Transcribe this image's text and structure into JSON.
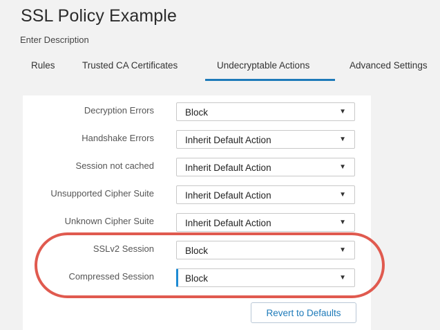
{
  "header": {
    "title": "SSL Policy Example",
    "description": "Enter Description"
  },
  "tabs": [
    {
      "label": "Rules",
      "active": false
    },
    {
      "label": "Trusted CA Certificates",
      "active": false
    },
    {
      "label": "Undecryptable Actions",
      "active": true
    },
    {
      "label": "Advanced Settings",
      "active": false
    }
  ],
  "actions": [
    {
      "label": "Decryption Errors",
      "value": "Block"
    },
    {
      "label": "Handshake Errors",
      "value": "Inherit Default Action"
    },
    {
      "label": "Session not cached",
      "value": "Inherit Default Action"
    },
    {
      "label": "Unsupported Cipher Suite",
      "value": "Inherit Default Action"
    },
    {
      "label": "Unknown Cipher Suite",
      "value": "Inherit Default Action"
    },
    {
      "label": "SSLv2 Session",
      "value": "Block"
    },
    {
      "label": "Compressed Session",
      "value": "Block"
    }
  ],
  "buttons": {
    "revert_label": "Revert to Defaults"
  },
  "icons": {
    "dropdown": "chevron-down-icon"
  },
  "colors": {
    "accent": "#1d7ab9",
    "highlight": "#e05a4f"
  }
}
